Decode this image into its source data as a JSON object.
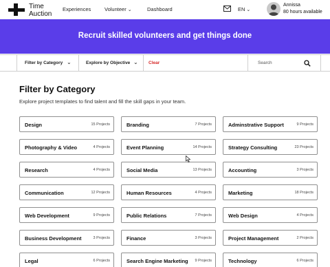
{
  "header": {
    "logo_text_line1": "Time",
    "logo_text_line2": "Auction",
    "nav": [
      "Experiences",
      "Volunteer",
      "Dashboard"
    ],
    "language": "EN",
    "user_name": "Annissa",
    "user_hours": "80 hours available"
  },
  "banner": {
    "title": "Recruit skilled volunteers and get things done",
    "color": "#5a3de9"
  },
  "filterbar": {
    "category_label": "Filter by Category",
    "objective_label": "Explore by Objective",
    "clear_label": "Clear",
    "search_placeholder": "Search"
  },
  "section": {
    "title": "Filter by Category",
    "description": "Explore project templates to find talent and fill the skill gaps in your team."
  },
  "categories": [
    {
      "name": "Design",
      "count": "15 Projects"
    },
    {
      "name": "Branding",
      "count": "7 Projects"
    },
    {
      "name": "Adminstrative Support",
      "count": "9 Projects"
    },
    {
      "name": "Photography & Video",
      "count": "4 Projects"
    },
    {
      "name": "Event Planning",
      "count": "14 Projects"
    },
    {
      "name": "Strategy Consulting",
      "count": "23 Projects"
    },
    {
      "name": "Research",
      "count": "4 Projects"
    },
    {
      "name": "Social Media",
      "count": "13 Projects"
    },
    {
      "name": "Accounting",
      "count": "3 Projects"
    },
    {
      "name": "Communication",
      "count": "12 Projects"
    },
    {
      "name": "Human Resources",
      "count": "4 Projects"
    },
    {
      "name": "Marketing",
      "count": "18 Projects"
    },
    {
      "name": "Web Development",
      "count": "9 Projects"
    },
    {
      "name": "Public Relations",
      "count": "7 Projects"
    },
    {
      "name": "Web Design",
      "count": "4 Projects"
    },
    {
      "name": "Business Development",
      "count": "3 Projects"
    },
    {
      "name": "Finance",
      "count": "3 Projects"
    },
    {
      "name": "Project Management",
      "count": "2 Projects"
    },
    {
      "name": "Legal",
      "count": "6 Projects"
    },
    {
      "name": "Search Engine Marketing",
      "count": "9 Projects"
    },
    {
      "name": "Technology",
      "count": "6 Projects"
    }
  ]
}
